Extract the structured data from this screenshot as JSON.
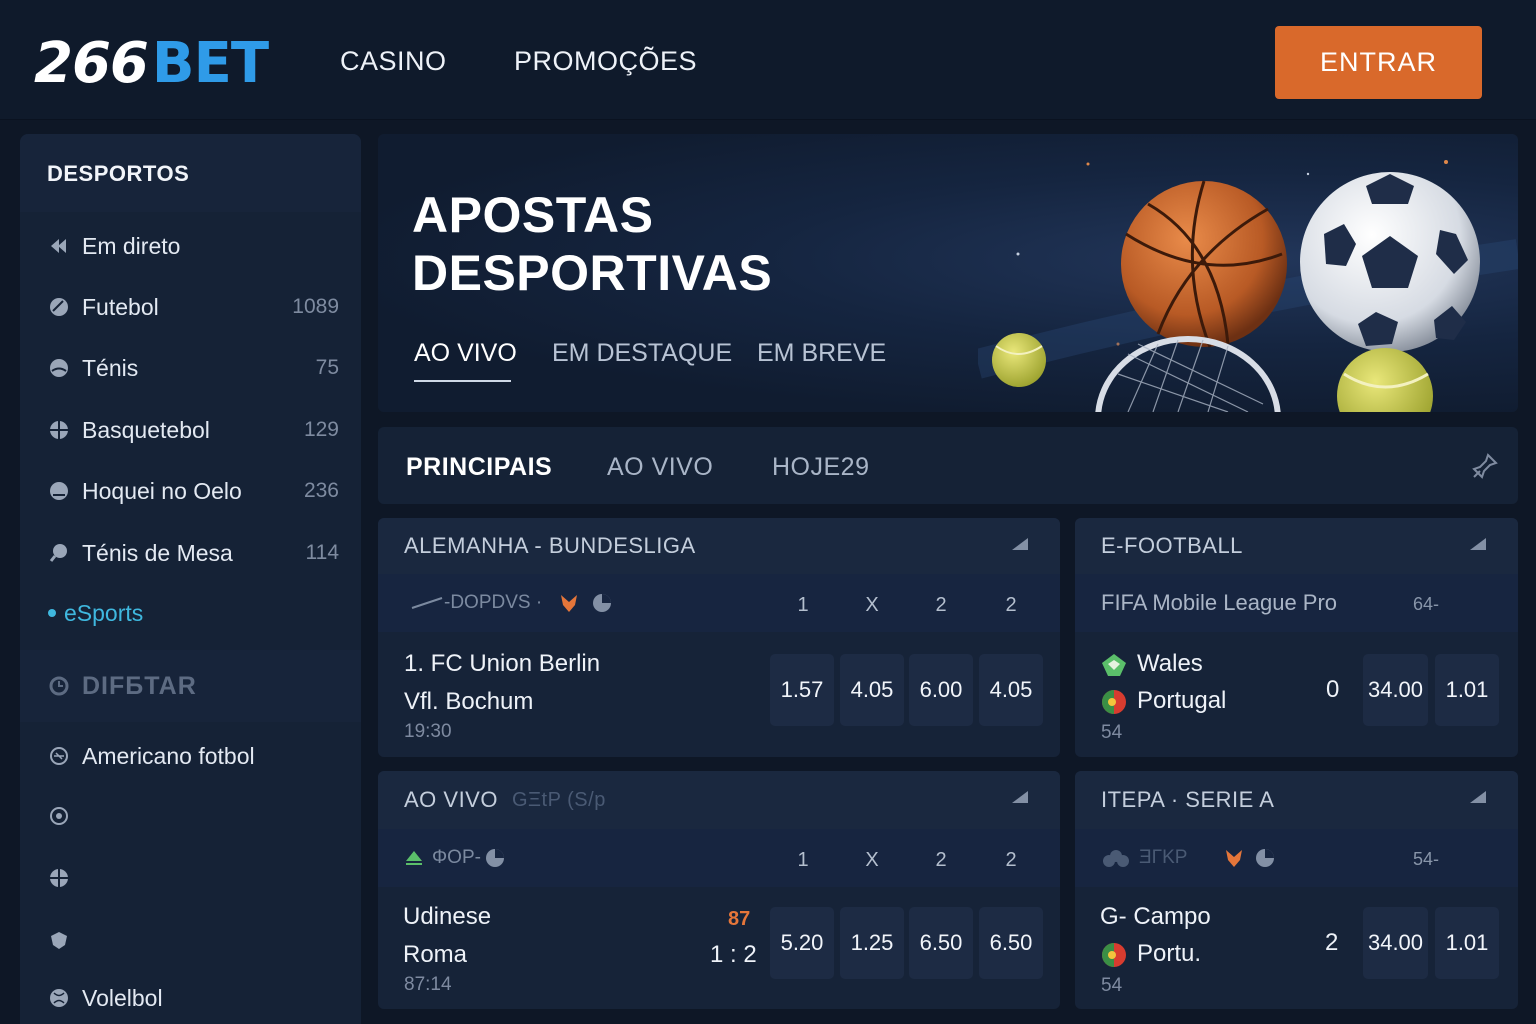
{
  "header": {
    "logo_part1": "266",
    "logo_part2": "BET",
    "nav": [
      "CASINO",
      "PROMOÇÕES"
    ],
    "login_label": "ENTRAR"
  },
  "sidebar": {
    "title": "DESPORTOS",
    "items": [
      {
        "label": "Em direto",
        "count": ""
      },
      {
        "label": "Futebol",
        "count": "1089"
      },
      {
        "label": "Ténis",
        "count": "75"
      },
      {
        "label": "Basquetebol",
        "count": "129"
      },
      {
        "label": "Hoquei no Oelo",
        "count": "236"
      },
      {
        "label": "Ténis de Mesa",
        "count": "114"
      },
      {
        "label": "eSports",
        "count": ""
      }
    ],
    "section_title": "DIFБTAR",
    "more_items": [
      {
        "label": "Americano fotbol"
      },
      {
        "label": ""
      },
      {
        "label": ""
      },
      {
        "label": ""
      },
      {
        "label": "Volelbol"
      }
    ]
  },
  "hero": {
    "title_line1": "APOSTAS",
    "title_line2": "DESPORTIVAS",
    "tabs": [
      "AO VIVO",
      "EM DESTAQUE",
      "EM BREVE"
    ]
  },
  "tabs": [
    "PRINCIPAIS",
    "AO VIVO",
    "HOJE29"
  ],
  "cards": {
    "bundesliga": {
      "title": "ALEMANHA - BUNDESLIGA",
      "sub": "-DOPDVS ·",
      "cols": [
        "1",
        "X",
        "2",
        "2"
      ],
      "home": "1. FC Union Berlin",
      "away": "Vfl.  Bochum",
      "time": "19:30",
      "odds": [
        "1.57",
        "4.05",
        "6.00",
        "4.05"
      ]
    },
    "efootball": {
      "title": "E-FOOTBALL",
      "sub": "FIFA Mobile League Pro",
      "sub_count": "64-",
      "home": "Wales",
      "away": "Portugal",
      "score": "0",
      "time": "54",
      "odds": [
        "34.00",
        "1.01"
      ]
    },
    "aovivo": {
      "title": "AO VIVO",
      "title_extra": "GΞtP (S/p",
      "sub": "ΦOP-",
      "cols": [
        "1",
        "X",
        "2",
        "2"
      ],
      "home": "Udinese",
      "away": "Roma",
      "live_min": "87",
      "score": "1 : 2",
      "time": "87:14",
      "odds": [
        "5.20",
        "1.25",
        "6.50",
        "6.50"
      ]
    },
    "seriea": {
      "title": "ITEPA · SERIE A",
      "sub": "ƎΓKP",
      "sub_count": "54-",
      "home": "G- Campo",
      "away": "Portu.",
      "score": "2",
      "time": "54",
      "odds": [
        "34.00",
        "1.01"
      ]
    }
  },
  "colors": {
    "accent_orange": "#d9692b",
    "accent_blue": "#2f9be8",
    "esports_cyan": "#3fb8df"
  }
}
